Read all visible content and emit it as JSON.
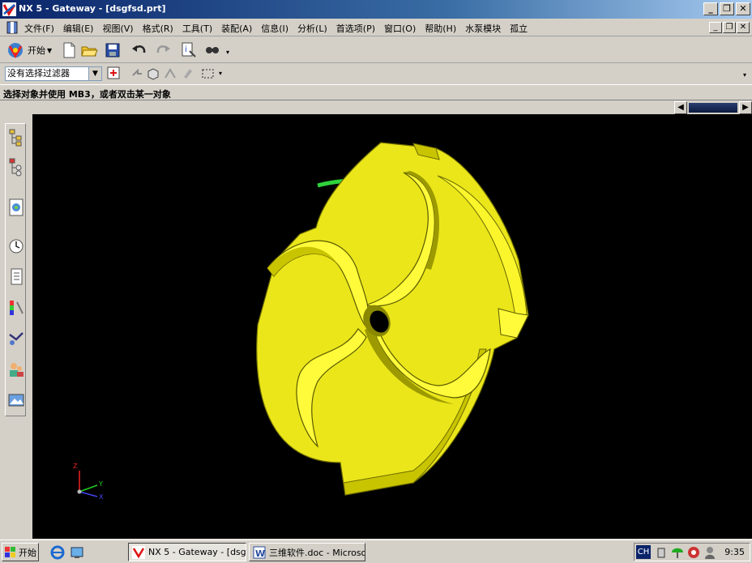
{
  "window": {
    "title": "NX 5 - Gateway - [dsgfsd.prt]",
    "controls": {
      "minimize": "_",
      "restore": "❐",
      "close": "✕"
    }
  },
  "menubar": {
    "items": [
      "文件(F)",
      "编辑(E)",
      "视图(V)",
      "格式(R)",
      "工具(T)",
      "装配(A)",
      "信息(I)",
      "分析(L)",
      "首选项(P)",
      "窗口(O)",
      "帮助(H)",
      "水泵模块",
      "孤立"
    ]
  },
  "toolbar": {
    "start_label": "开始",
    "overflow": "▾"
  },
  "selection_bar": {
    "filter_value": "没有选择过滤器",
    "overflow": "▾"
  },
  "status": {
    "prompt": "选择对象并使用 MB3，或者双击某一对象"
  },
  "viewport": {
    "background": "#000000",
    "model_color": "#f2ee1a",
    "model_shadow": "#9c9a00",
    "accent_green": "#2fd23c",
    "triad": {
      "x": "X",
      "y": "Y",
      "z": "Z"
    }
  },
  "taskbar": {
    "start_label": "开始",
    "tasks": [
      {
        "label": "NX 5 - Gateway - [dsgfs...",
        "active": true
      },
      {
        "label": "三维软件.doc - Microso...",
        "active": false
      }
    ],
    "tray": {
      "lang": "CH",
      "clock": "9:35"
    }
  },
  "colors": {
    "title_gradient_start": "#0a246a",
    "chrome": "#d4d0c8"
  }
}
